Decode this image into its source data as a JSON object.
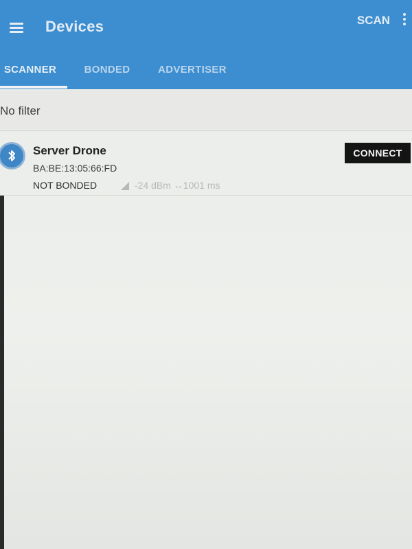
{
  "appbar": {
    "title": "Devices",
    "scan_label": "SCAN",
    "menu_icon": "menu-icon",
    "overflow_icon": "more-vert-icon"
  },
  "tabs": [
    {
      "label": "SCANNER",
      "active": true
    },
    {
      "label": "BONDED",
      "active": false
    },
    {
      "label": "ADVERTISER",
      "active": false
    }
  ],
  "filter": {
    "label": "No filter"
  },
  "devices": [
    {
      "name": "Server Drone",
      "address": "BA:BE:13:05:66:FD",
      "bond_status": "NOT BONDED",
      "rssi_text": "-24 dBm  ↔1001 ms",
      "connect_label": "CONNECT",
      "icon": "bluetooth-icon"
    }
  ],
  "colors": {
    "primary": "#3c8ed0",
    "connect_bg": "#141414",
    "background": "#eceeeb"
  }
}
